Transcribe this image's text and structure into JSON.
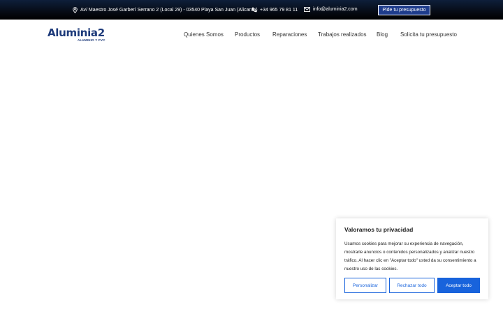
{
  "topbar": {
    "address": "Av/ Maestro José Garberí Serrano 2 (Local 29) - 03540 Playa San Juan (Alicante)",
    "phone": "+34 965 79 81 11",
    "email": "info@aluminia2.com",
    "quote_button": "Pide tu presupuesto",
    "icons": [
      "location-pin-icon",
      "phone-icon",
      "envelope-icon"
    ]
  },
  "logo": {
    "word": "Aluminia2",
    "tagline": "ALUMINIO Y PVC",
    "color": "#1d3a7a"
  },
  "nav": {
    "items": [
      {
        "label": "Quienes Somos"
      },
      {
        "label": "Productos"
      },
      {
        "label": "Reparaciones"
      },
      {
        "label": "Trabajos realizados"
      },
      {
        "label": "Blog"
      },
      {
        "label": "Solicita tu presupuesto"
      }
    ]
  },
  "cookie_banner": {
    "title": "Valoramos tu privacidad",
    "text": "Usamos cookies para mejorar su experiencia de navegación, mostrarle anuncios o contenidos personalizados y analizar nuestro tráfico. Al hacer clic en \"Aceptar todo\" usted da su consentimiento a nuestro uso de las cookies.",
    "buttons": {
      "customize": "Personalizar",
      "reject": "Rechazar todo",
      "accept": "Aceptar todo"
    },
    "accent_color": "#1863dc"
  }
}
